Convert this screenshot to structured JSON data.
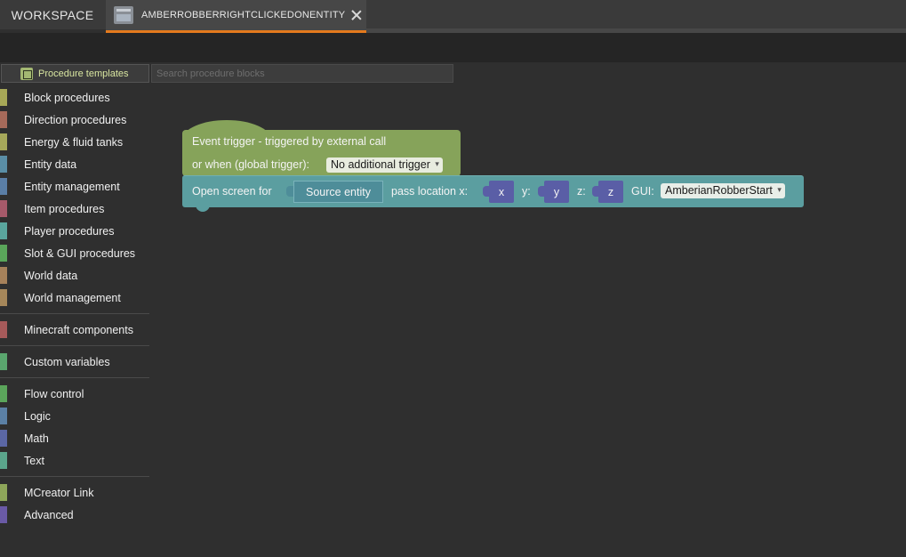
{
  "tabs": {
    "workspace_label": "WORKSPACE",
    "active_label": "AMBERROBBERRIGHTCLICKEDONENTITY",
    "active_icon": "procedure-file-icon",
    "close_icon": "close-icon"
  },
  "search": {
    "templates_label": "Procedure templates",
    "templates_icon": "templates-icon",
    "placeholder": "Search procedure blocks"
  },
  "sidebar": {
    "groups": [
      [
        {
          "label": "Block procedures",
          "color": "#a7a857"
        },
        {
          "label": "Direction procedures",
          "color": "#a66a5a"
        },
        {
          "label": "Energy & fluid tanks",
          "color": "#a6a85a"
        },
        {
          "label": "Entity data",
          "color": "#5a8ea6"
        },
        {
          "label": "Entity management",
          "color": "#5a7ea6"
        },
        {
          "label": "Item procedures",
          "color": "#a65a6a"
        },
        {
          "label": "Player procedures",
          "color": "#5aa69e"
        },
        {
          "label": "Slot & GUI procedures",
          "color": "#5aa65a"
        },
        {
          "label": "World data",
          "color": "#a6815a"
        },
        {
          "label": "World management",
          "color": "#a6875a"
        }
      ],
      [
        {
          "label": "Minecraft components",
          "color": "#a65a5a"
        }
      ],
      [
        {
          "label": "Custom variables",
          "color": "#5aa66e"
        }
      ],
      [
        {
          "label": "Flow control",
          "color": "#5ba55b"
        },
        {
          "label": "Logic",
          "color": "#5b80a5"
        },
        {
          "label": "Math",
          "color": "#5b67a5"
        },
        {
          "label": "Text",
          "color": "#5ba58c"
        }
      ],
      [
        {
          "label": "MCreator Link",
          "color": "#8ea65a"
        },
        {
          "label": "Advanced",
          "color": "#6a5aa6"
        }
      ]
    ]
  },
  "workspace": {
    "event_block": {
      "line1": "Event trigger - triggered by external call",
      "line2": "or when (global trigger):",
      "trigger_value": "No additional trigger",
      "color": "#86a35a"
    },
    "action_block": {
      "open_label": "Open screen for",
      "entity_value": "Source entity",
      "pass_label": "pass location x:",
      "x_value": "x",
      "y_label": "y:",
      "y_value": "y",
      "z_label": "z:",
      "z_value": "z",
      "gui_label": "GUI:",
      "gui_value": "AmberianRobberStart",
      "color": "#5b9ea0",
      "var_color": "#5a5ea6"
    }
  }
}
